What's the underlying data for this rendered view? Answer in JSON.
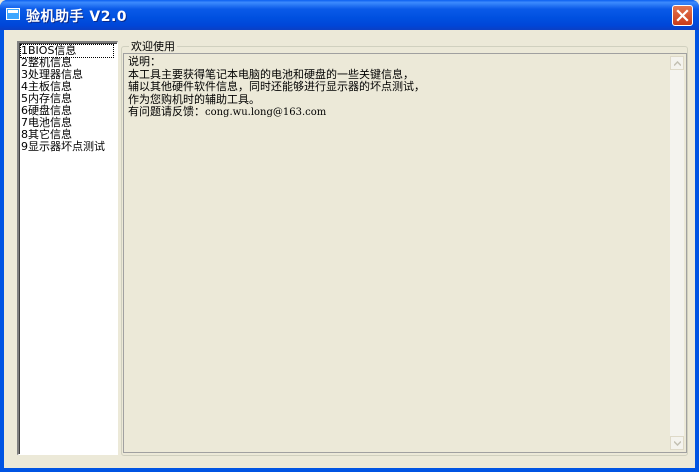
{
  "window": {
    "title": "验机助手 V2.0"
  },
  "menu_list": {
    "items": [
      {
        "label": "1BIOS信息",
        "selected": true
      },
      {
        "label": "2整机信息"
      },
      {
        "label": "3处理器信息"
      },
      {
        "label": "4主板信息"
      },
      {
        "label": "5内存信息"
      },
      {
        "label": "6硬盘信息"
      },
      {
        "label": "7电池信息"
      },
      {
        "label": "8其它信息"
      },
      {
        "label": "9显示器坏点测试"
      }
    ]
  },
  "content": {
    "group_title": "欢迎使用",
    "lines": [
      "说明：",
      "本工具主要获得笔记本电脑的电池和硬盘的一些关键信息，",
      "辅以其他硬件软件信息，同时还能够进行显示器的坏点测试，",
      "作为您购机时的辅助工具。"
    ],
    "feedback_label": "有问题请反馈：",
    "feedback_email": "cong.wu.long@163.com"
  },
  "icons": {
    "app": "window-app-icon",
    "close": "close-icon",
    "scroll_up": "chevron-up-icon",
    "scroll_down": "chevron-down-icon"
  },
  "colors": {
    "titlebar": "#0054e3",
    "close_button": "#d1502c",
    "background": "#ece9d8"
  }
}
